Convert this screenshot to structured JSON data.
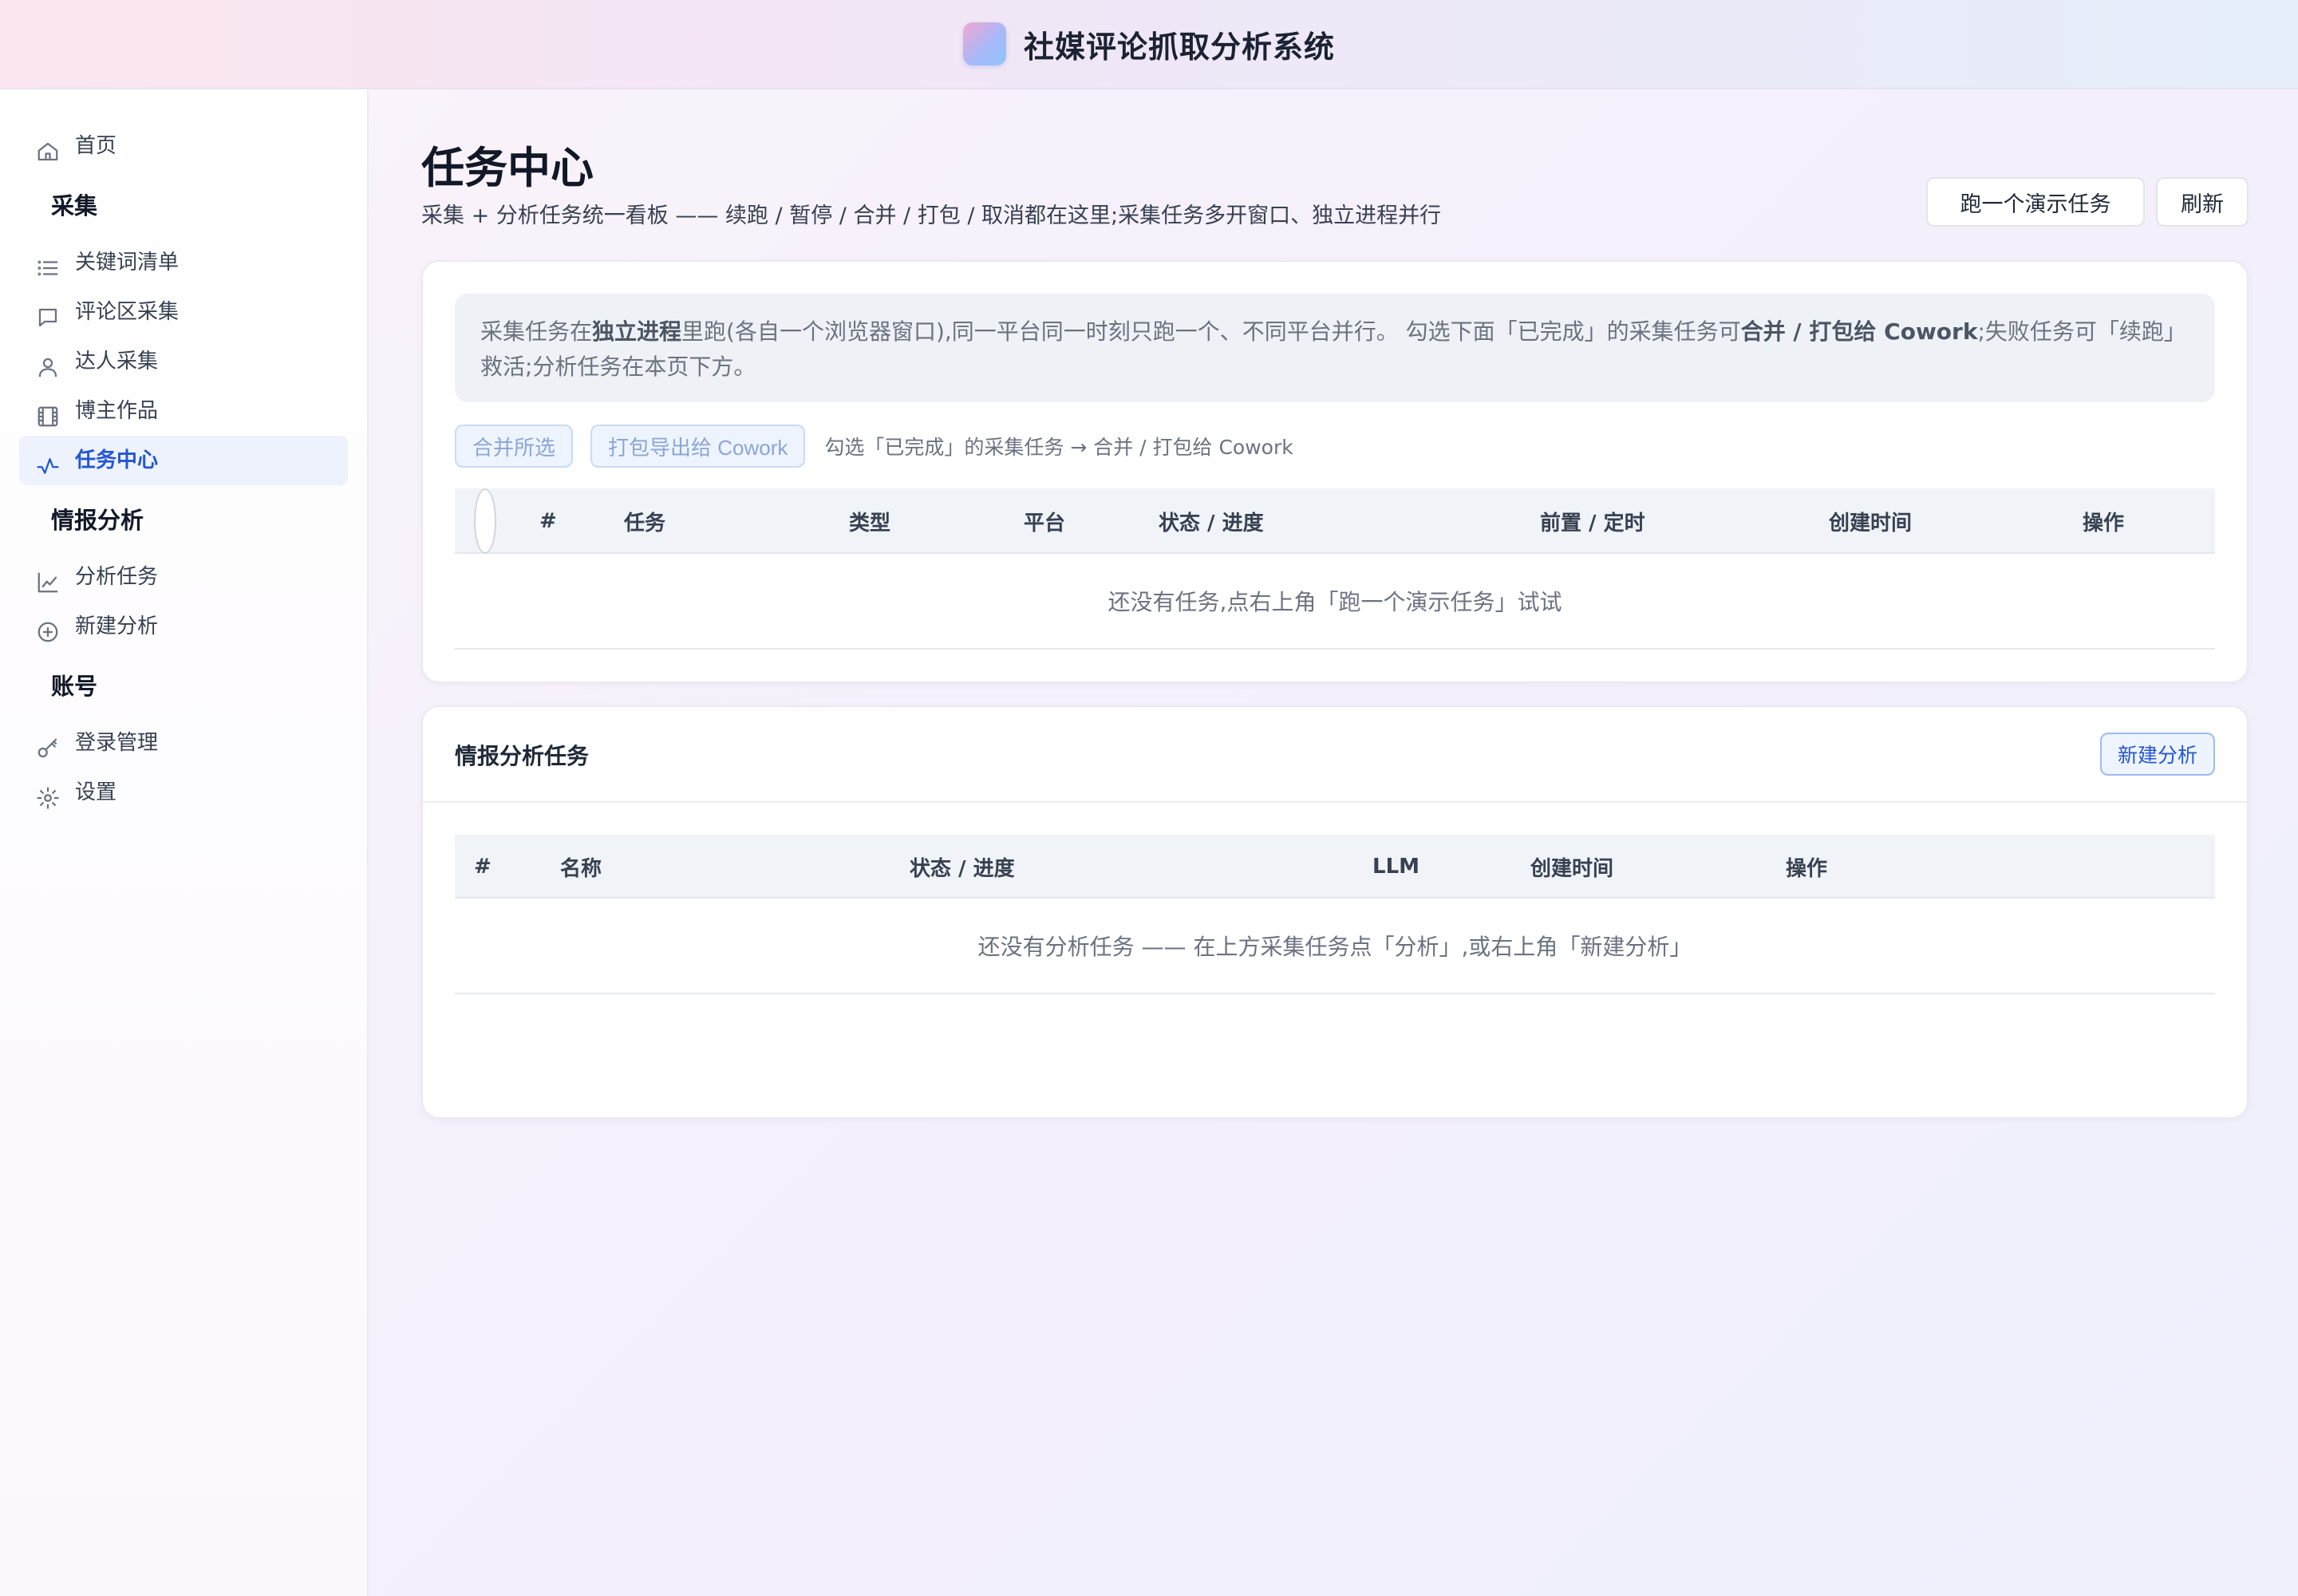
{
  "app": {
    "title": "社媒评论抓取分析系统"
  },
  "sidebar": {
    "home": "首页",
    "sections": [
      {
        "title": "采集",
        "items": [
          "关键词清单",
          "评论区采集",
          "达人采集",
          "博主作品",
          "任务中心"
        ]
      },
      {
        "title": "情报分析",
        "items": [
          "分析任务",
          "新建分析"
        ]
      },
      {
        "title": "账号",
        "items": [
          "登录管理",
          "设置"
        ]
      }
    ],
    "active_item": "任务中心"
  },
  "page": {
    "title": "任务中心",
    "subtitle": "采集 + 分析任务统一看板 —— 续跑 / 暂停 / 合并 / 打包 / 取消都在这里;采集任务多开窗口、独立进程并行",
    "demo_button": "跑一个演示任务",
    "refresh_button": "刷新"
  },
  "collect_panel": {
    "notice_parts": [
      "采集任务在",
      "独立进程",
      "里跑(各自一个浏览器窗口),同一平台同一时刻只跑一个、不同平台并行。 勾选下面「已完成」的采集任务可",
      "合并 / 打包给 Cowork",
      ";失败任务可「续跑」救活;分析任务在本页下方。"
    ],
    "merge_button": "合并所选",
    "export_button": "打包导出给 Cowork",
    "hint": "勾选「已完成」的采集任务 → 合并 / 打包给 Cowork",
    "columns": [
      "#",
      "任务",
      "类型",
      "平台",
      "状态 / 进度",
      "前置 / 定时",
      "创建时间",
      "操作"
    ],
    "empty_text": "还没有任务,点右上角「跑一个演示任务」试试"
  },
  "analysis_panel": {
    "title": "情报分析任务",
    "new_button": "新建分析",
    "columns": [
      "#",
      "名称",
      "状态 / 进度",
      "LLM",
      "创建时间",
      "操作"
    ],
    "empty_text": "还没有分析任务 —— 在上方采集任务点「分析」,或右上角「新建分析」"
  },
  "colors": {
    "accent": "#2456d4",
    "active_bg": "#edf2fd",
    "table_header_bg": "#f0f3f8"
  }
}
